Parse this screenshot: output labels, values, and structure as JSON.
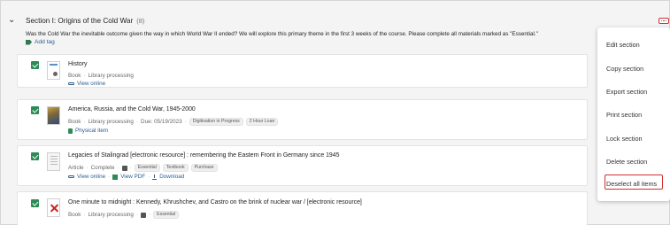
{
  "section": {
    "title": "Section I: Origins of the Cold War",
    "count": "(8)",
    "description": "Was the Cold War the inevitable outcome given the way in which World War II ended? We will explore this primary theme in the first 3 weeks of the course. Please complete all materials marked as \"Essential.\"",
    "add_tag": "Add tag"
  },
  "items": [
    {
      "title": "History",
      "meta": [
        "Book",
        "Library processing"
      ],
      "chips": [],
      "links": [
        "View online"
      ]
    },
    {
      "title": "America, Russia, and the Cold War, 1945-2000",
      "meta": [
        "Book",
        "Library processing",
        "Due: 05/19/2023"
      ],
      "chips": [
        "Digitisation in Progress",
        "2 Hour Loan"
      ],
      "links": [
        "Physical item"
      ]
    },
    {
      "title": "Legacies of Stalingrad [electronic resource] : remembering the Eastern Front in Germany since 1945",
      "meta": [
        "Article",
        "Complete"
      ],
      "chips": [
        "Essential",
        "Textbook",
        "Purchase"
      ],
      "links": [
        "View online",
        "View PDF",
        "Download"
      ]
    },
    {
      "title": "One minute to midnight : Kennedy, Khrushchev, and Castro on the brink of nuclear war / [electronic resource]",
      "meta": [
        "Book",
        "Library processing"
      ],
      "chips": [
        "Essential"
      ],
      "links": []
    }
  ],
  "menu": {
    "items": [
      "Edit section",
      "Copy section",
      "Export section",
      "Print section",
      "Lock section",
      "Delete section",
      "Deselect all items"
    ]
  },
  "colors": {
    "accent_green": "#2e8b57",
    "highlight_red": "#d32f2f",
    "link_blue": "#2c5d8f"
  }
}
